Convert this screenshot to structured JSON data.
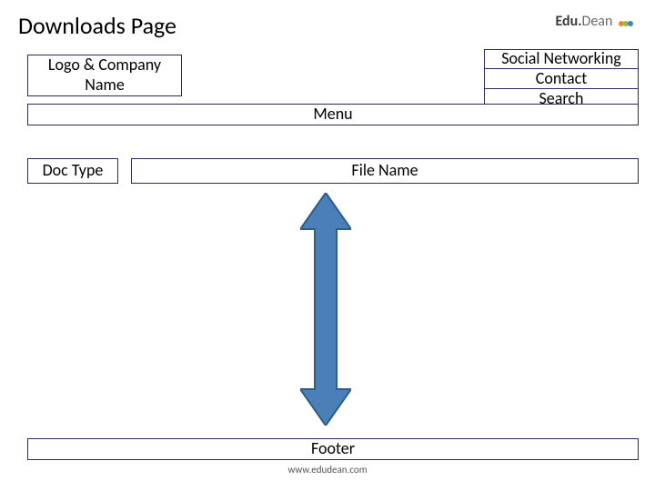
{
  "title": "Downloads Page",
  "brand": {
    "part1": "Edu.",
    "part2": "Dean"
  },
  "boxes": {
    "logo_company": "Logo & Company Name",
    "social": "Social Networking",
    "contact": "Contact",
    "search": "Search",
    "menu": "Menu",
    "doc_type": "Doc Type",
    "file_name": "File Name",
    "footer": "Footer"
  },
  "footer_url": "www.edudean.com",
  "arrow_fill": "#4a7fb7",
  "arrow_stroke": "#2f5d8a"
}
